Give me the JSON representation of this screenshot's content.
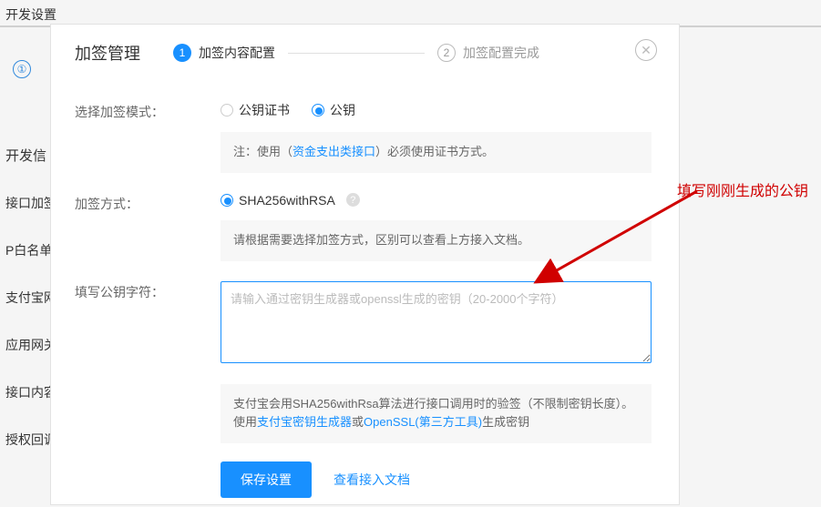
{
  "bg": {
    "title": "开发设置",
    "circle": "①",
    "section_title": "开发信",
    "sidebar": [
      "接口加签",
      "P白名单",
      "支付宝网",
      "应用网关",
      "接口内容",
      "授权回调"
    ]
  },
  "modal": {
    "title": "加签管理",
    "step1_num": "1",
    "step1_label": "加签内容配置",
    "step2_num": "2",
    "step2_label": "加签配置完成",
    "close_symbol": "✕"
  },
  "form": {
    "mode_label": "选择加签模式：",
    "mode_option1": "公钥证书",
    "mode_option2": "公钥",
    "mode_note_prefix": "注：使用（",
    "mode_note_link": "资金支出类接口",
    "mode_note_suffix": "）必须使用证书方式。",
    "method_label": "加签方式：",
    "method_option": "SHA256withRSA",
    "method_note": "请根据需要选择加签方式，区别可以查看上方接入文档。",
    "pubkey_label": "填写公钥字符：",
    "pubkey_placeholder": "请输入通过密钥生成器或openssl生成的密钥（20-2000个字符）",
    "pubkey_note_1": "支付宝会用SHA256withRsa算法进行接口调用时的验签（不限制密钥长度）。使用",
    "pubkey_link1": "支付宝密钥生成器",
    "pubkey_note_or": "或",
    "pubkey_link2": "OpenSSL(第三方工具)",
    "pubkey_note_2": "生成密钥",
    "save_label": "保存设置",
    "doc_link": "查看接入文档"
  },
  "annotation": "填写刚刚生成的公钥"
}
